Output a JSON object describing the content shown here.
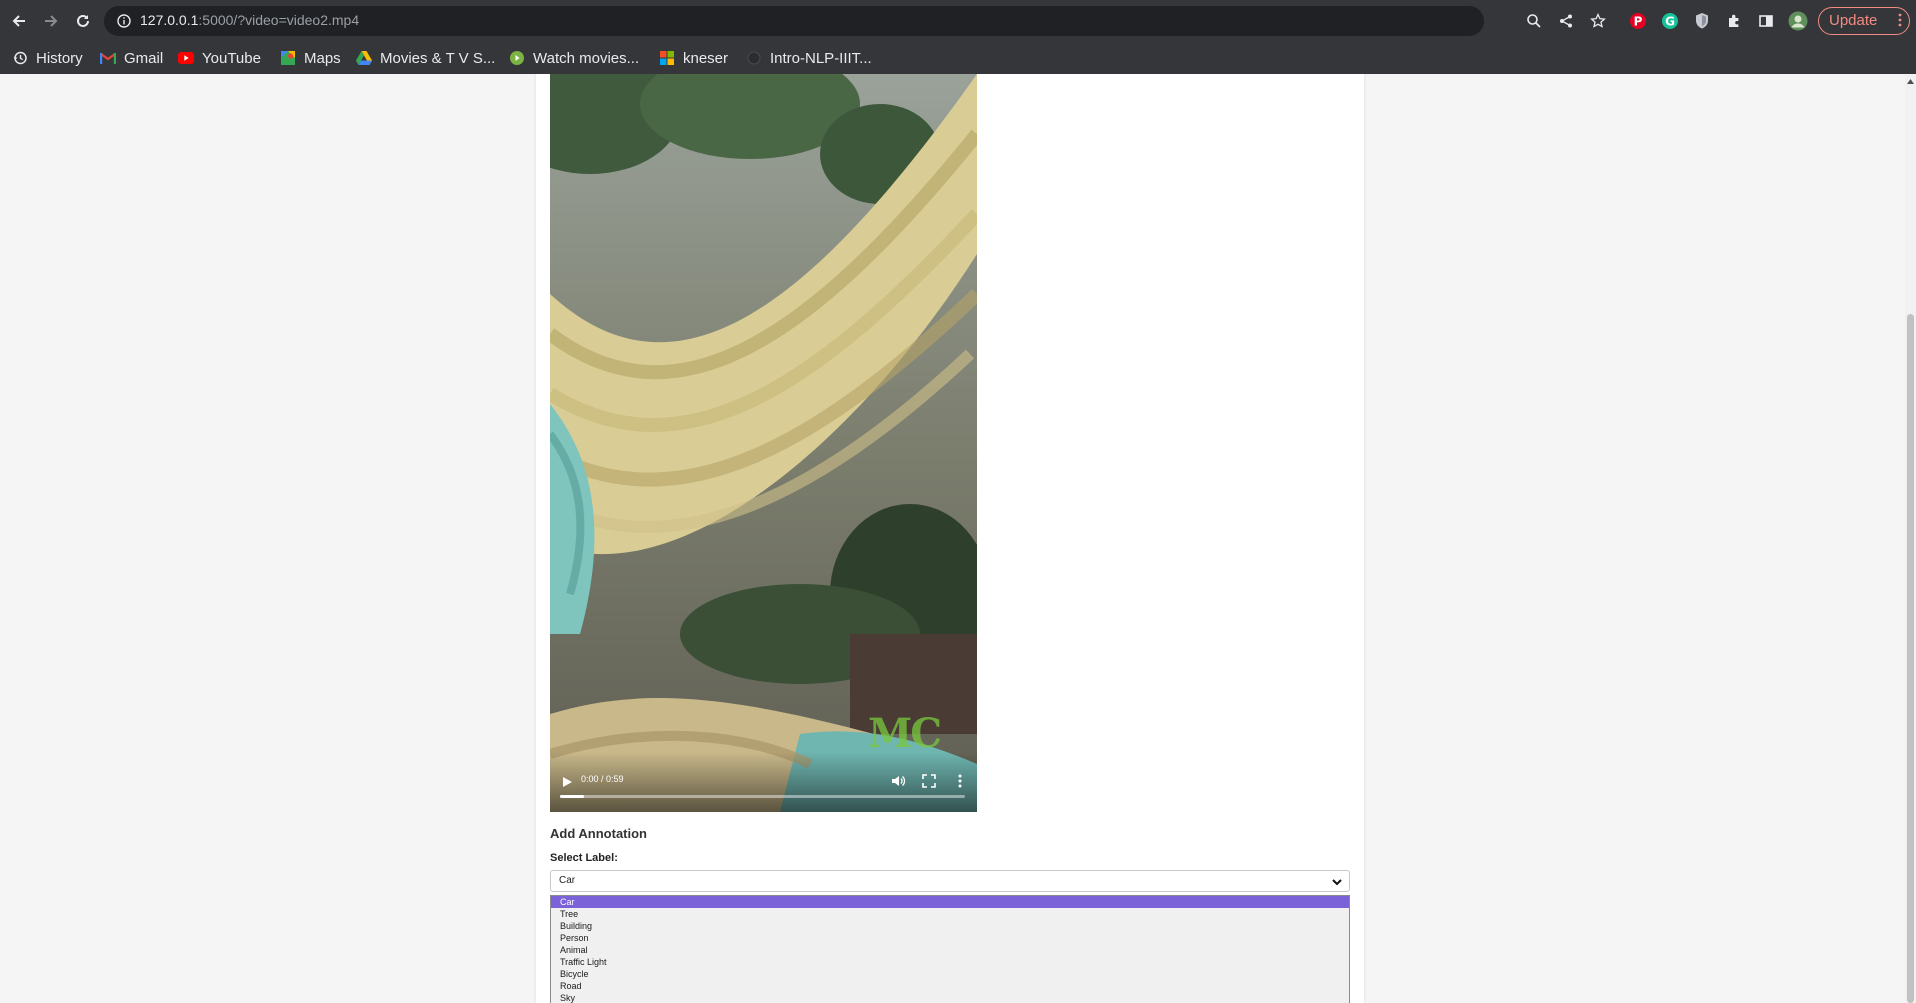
{
  "browser": {
    "url_host": "127.0.0.1",
    "url_rest": ":5000/?video=video2.mp4",
    "update_label": "Update",
    "bookmarks": [
      {
        "label": "History",
        "icon": "history-icon"
      },
      {
        "label": "Gmail",
        "icon": "gmail-icon"
      },
      {
        "label": "YouTube",
        "icon": "youtube-icon"
      },
      {
        "label": "Maps",
        "icon": "maps-icon"
      },
      {
        "label": "Movies & T V S...",
        "icon": "drive-icon"
      },
      {
        "label": "Watch movies...",
        "icon": "play-circle-icon"
      },
      {
        "label": "kneser",
        "icon": "microsoft-icon"
      },
      {
        "label": "Intro-NLP-IIIT...",
        "icon": "globe-icon"
      }
    ]
  },
  "video": {
    "time": "0:00 / 0:59",
    "watermark": "MC",
    "progress": 0.06
  },
  "annotation": {
    "title": "Add Annotation",
    "select_label": "Select Label:",
    "selected_value": "Car",
    "options": [
      "Car",
      "Tree",
      "Building",
      "Person",
      "Animal",
      "Traffic Light",
      "Bicycle",
      "Road",
      "Sky"
    ]
  },
  "colors": {
    "chrome_bg": "#35363a",
    "omnibox_bg": "#202124",
    "update_accent": "#f28b82",
    "selected_option": "#7b62d8"
  }
}
